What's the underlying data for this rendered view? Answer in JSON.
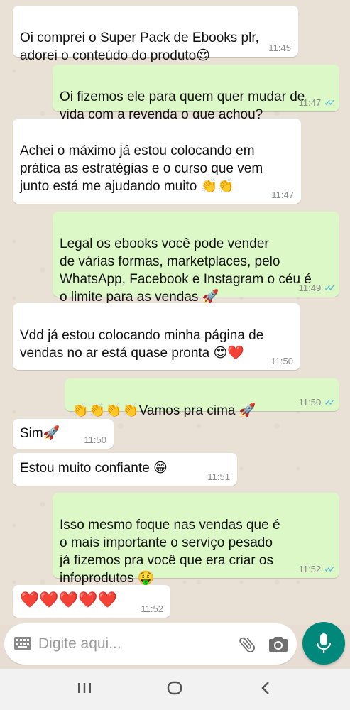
{
  "messages": [
    {
      "text": "Oi comprei o Super Pack de Ebooks plr,\nadorei o conteúdo do produto😍",
      "time": "11:45"
    },
    {
      "text": "Oi fizemos ele para quem quer mudar de\nvida com a revenda o que achou?",
      "time": "11:47"
    },
    {
      "text": "Achei o máximo já estou colocando em\nprática as estratégias e o curso que vem\njunto está me ajudando muito 👏👏",
      "time": "11:47"
    },
    {
      "text": "Legal os ebooks você pode vender\nde várias formas, marketplaces, pelo\nWhatsApp, Facebook e Instagram o céu é\no limite para as vendas 🚀",
      "time": "11:49"
    },
    {
      "text": "Vdd já estou colocando minha página de\nvendas no ar está quase pronta 😍❤️",
      "time": "11:50"
    },
    {
      "text": "👏👏👏👏Vamos pra cima 🚀",
      "time": "11:50"
    },
    {
      "text": "Sim🚀",
      "time": "11:50"
    },
    {
      "text": "Estou muito confiante 😁",
      "time": "11:51"
    },
    {
      "text": "Isso mesmo foque nas vendas que é\no mais importante o serviço pesado\njá fizemos pra você que era criar os\ninfoprodutos 🤑",
      "time": "11:52"
    },
    {
      "text": "❤️❤️❤️❤️❤️",
      "time": "11:52"
    }
  ],
  "input": {
    "placeholder": "Digite aqui..."
  },
  "colors": {
    "incoming": "#ffffff",
    "outgoing": "#dcf8c6",
    "accent": "#00897b",
    "read_ticks": "#4fb6ec"
  },
  "icons": [
    "keyboard-icon",
    "paperclip-icon",
    "camera-icon",
    "microphone-icon",
    "recent-apps-icon",
    "home-icon",
    "back-icon"
  ]
}
